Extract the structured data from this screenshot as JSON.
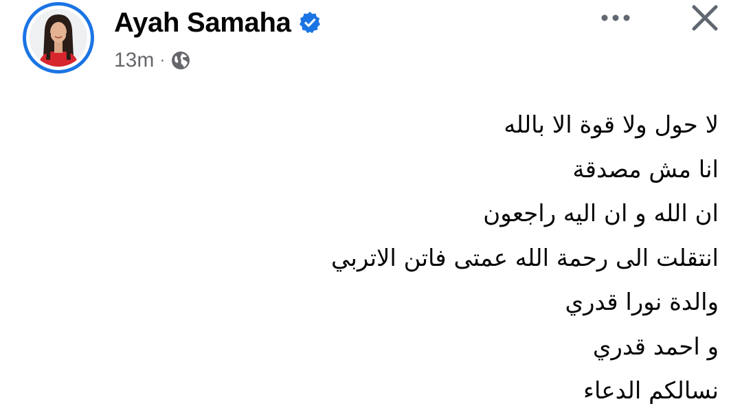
{
  "post": {
    "author": {
      "name": "Ayah Samaha",
      "verified": true,
      "avatar": "profile-photo"
    },
    "timestamp": "13m",
    "separator": "·",
    "audience_icon": "globe-icon",
    "actions": {
      "more_icon": "more-horizontal-icon",
      "close_icon": "close-icon"
    },
    "body_lines": [
      "لا حول ولا قوة الا بالله",
      "انا مش مصدقة",
      "ان الله و ان اليه راجعون",
      "انتقلت الى رحمة الله عمتى فاتن الاتربي",
      "والدة نورا قدري",
      "و احمد قدري",
      "نسالكم الدعاء"
    ]
  },
  "colors": {
    "accent": "#1b74e4",
    "text": "#050505",
    "secondary_text": "#65676b",
    "icon": "#606770"
  }
}
